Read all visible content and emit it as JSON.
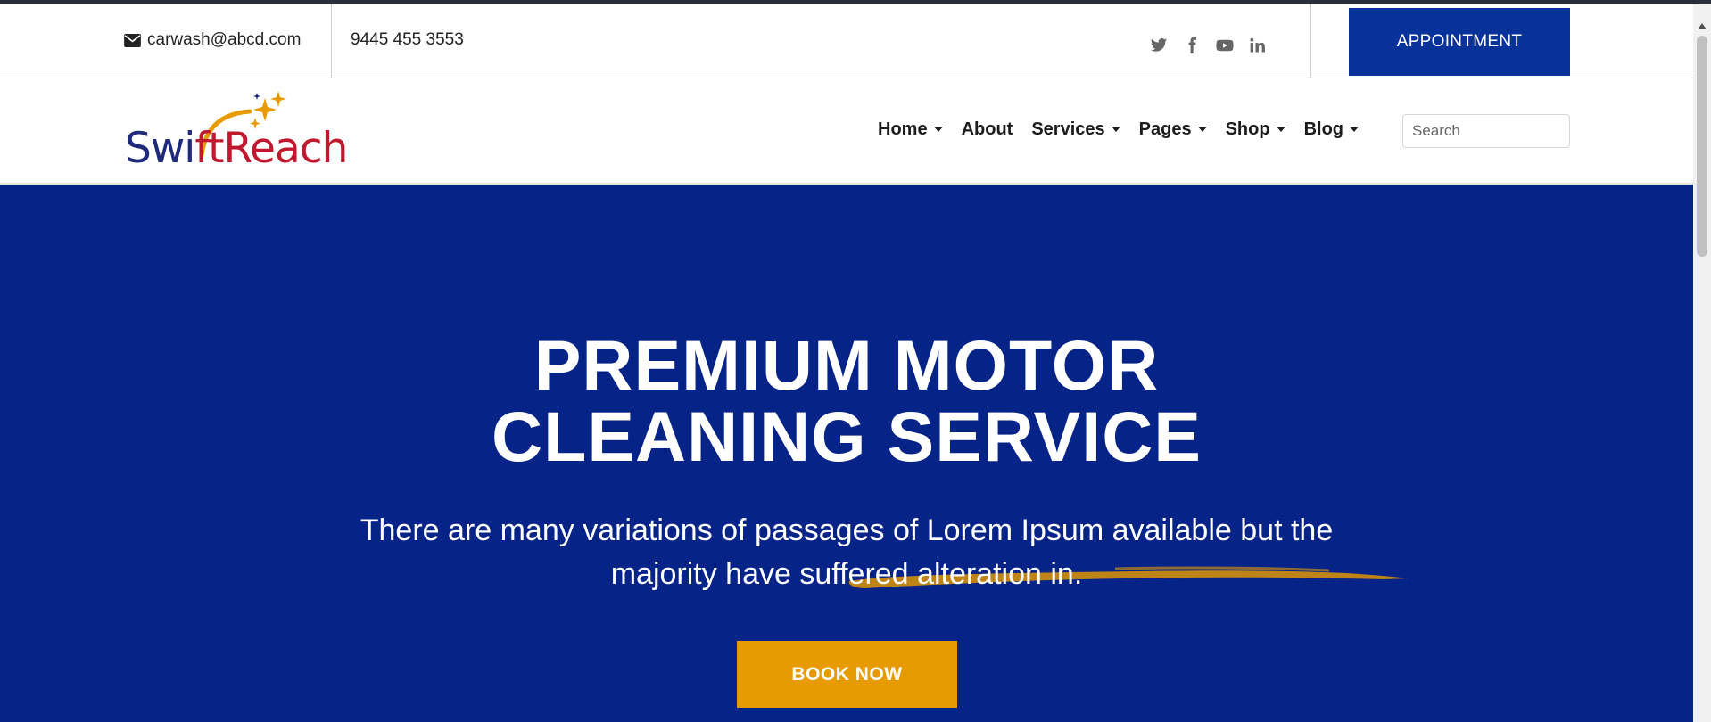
{
  "topbar": {
    "email": "carwash@abcd.com",
    "email_icon": "envelope-icon",
    "phone": "9445 455 3553",
    "social": [
      "twitter-icon",
      "facebook-icon",
      "youtube-icon",
      "linkedin-icon"
    ],
    "appointment_label": "APPOINTMENT"
  },
  "brand": {
    "name": "SwiftReach",
    "part1": "Swi",
    "part2": "ftReach"
  },
  "nav": {
    "items": [
      {
        "label": "Home",
        "dropdown": true
      },
      {
        "label": "About",
        "dropdown": false
      },
      {
        "label": "Services",
        "dropdown": true
      },
      {
        "label": "Pages",
        "dropdown": true
      },
      {
        "label": "Shop",
        "dropdown": true
      },
      {
        "label": "Blog",
        "dropdown": true
      }
    ],
    "search_placeholder": "Search"
  },
  "hero": {
    "title_line1": "PREMIUM MOTOR",
    "title_line2": "CLEANING SERVICE",
    "subtitle_line1": "There are many variations of passages of Lorem Ipsum available but the",
    "subtitle_line2": "majority have suffered alteration in.",
    "cta_label": "BOOK NOW"
  },
  "colors": {
    "primary_blue": "#06329a",
    "hero_bg": "#062388",
    "accent_orange": "#e89b00",
    "logo_navy": "#1f2a7a",
    "logo_red": "#c0182e"
  }
}
